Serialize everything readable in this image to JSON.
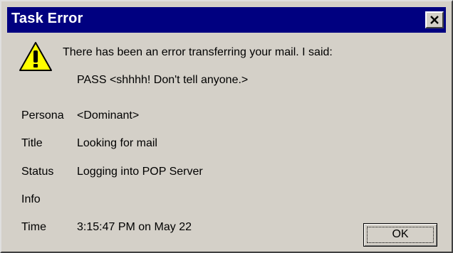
{
  "window": {
    "title": "Task Error",
    "close_icon": "close-icon"
  },
  "message": {
    "icon": "warning-icon",
    "line1": "There has been an error transferring your mail.  I said:",
    "line2": "PASS <shhhh!  Don't tell anyone.>"
  },
  "details": [
    {
      "label": "Persona",
      "value": "<Dominant>"
    },
    {
      "label": "Title",
      "value": "Looking for mail"
    },
    {
      "label": "Status",
      "value": "Logging into POP Server"
    },
    {
      "label": "Info",
      "value": ""
    },
    {
      "label": "Time",
      "value": "3:15:47 PM on May 22"
    }
  ],
  "buttons": {
    "ok_label": "OK"
  },
  "colors": {
    "titlebar": "#000080",
    "dialog_bg": "#d4d0c8",
    "warning_fill": "#ffff00"
  }
}
